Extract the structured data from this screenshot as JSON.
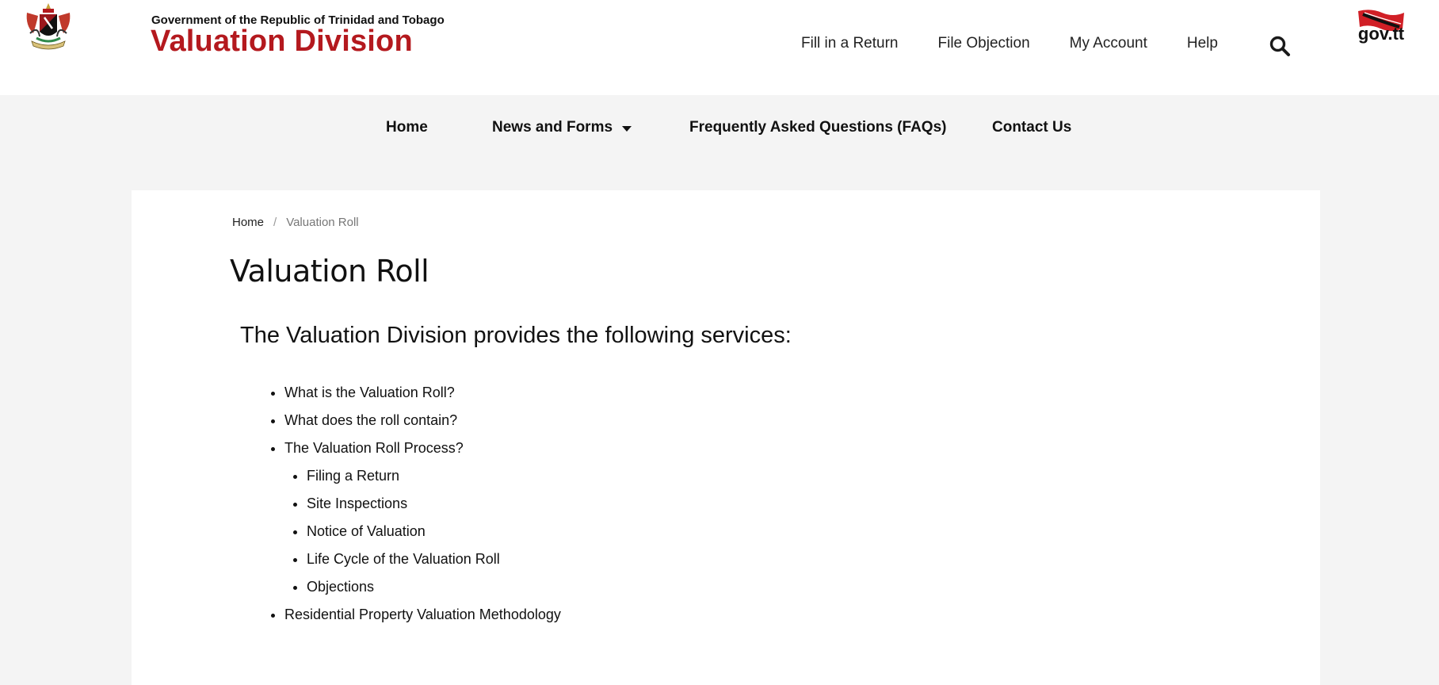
{
  "header": {
    "gov_line": "Government of the Republic of Trinidad and Tobago",
    "site_title": "Valuation Division",
    "logo_icon": "coat-of-arms-icon",
    "govtt_logo": "gov.tt",
    "utility_nav": [
      {
        "label": "Fill in a Return"
      },
      {
        "label": "File Objection"
      },
      {
        "label": "My Account"
      },
      {
        "label": "Help"
      }
    ],
    "search_icon": "search-icon"
  },
  "main_nav": {
    "items": [
      {
        "label": "Home"
      },
      {
        "label": "News and Forms"
      },
      {
        "label": "Frequently Asked Questions (FAQs)"
      },
      {
        "label": "Contact Us"
      }
    ]
  },
  "breadcrumb": {
    "home": "Home",
    "separator": "/",
    "current": "Valuation Roll"
  },
  "content": {
    "page_title": "Valuation Roll",
    "section_heading": "The Valuation Division provides the following services:",
    "services": [
      {
        "label": "What is the Valuation Roll?"
      },
      {
        "label": "What does the roll contain?"
      },
      {
        "label": "The Valuation Roll Process?",
        "children": [
          {
            "label": "Filing a Return"
          },
          {
            "label": "Site Inspections"
          },
          {
            "label": "Notice of Valuation"
          },
          {
            "label": "Life Cycle of the Valuation Roll"
          },
          {
            "label": "Objections"
          }
        ]
      },
      {
        "label": "Residential Property Valuation Methodology"
      }
    ]
  },
  "colors": {
    "brand_red": "#b4191e",
    "nav_background": "#f4f4f4",
    "card_background": "#ffffff"
  }
}
